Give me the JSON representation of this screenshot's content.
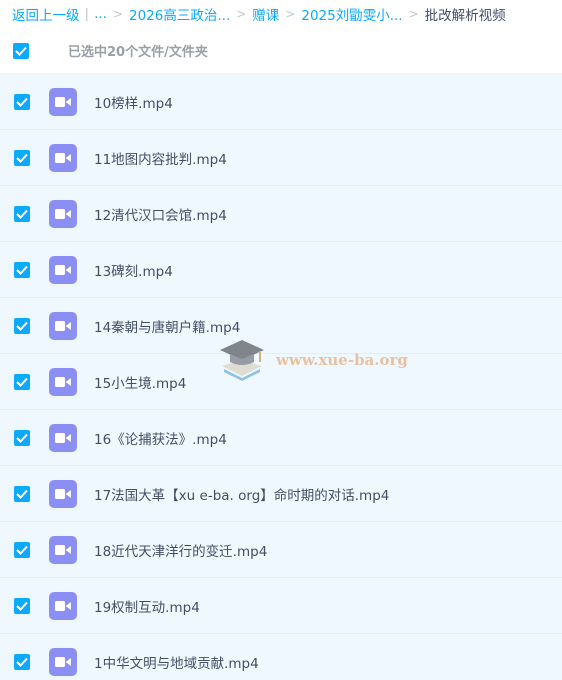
{
  "breadcrumb": {
    "back": "返回上一级",
    "ellipsis": "...",
    "items": [
      "2026高三政治...",
      "赠课",
      "2025刘勖雯小...",
      "批改解析视频"
    ]
  },
  "selection": {
    "label": "已选中20个文件/文件夹"
  },
  "files": [
    {
      "name": "10榜样.mp4"
    },
    {
      "name": "11地图内容批判.mp4"
    },
    {
      "name": "12清代汉口会馆.mp4"
    },
    {
      "name": "13碑刻.mp4"
    },
    {
      "name": "14秦朝与唐朝户籍.mp4"
    },
    {
      "name": "15小生境.mp4"
    },
    {
      "name": "16《论捕获法》.mp4"
    },
    {
      "name": "17法国大革【xu e-ba. org】命时期的对话.mp4"
    },
    {
      "name": "18近代天津洋行的变迁.mp4"
    },
    {
      "name": "19权制互动.mp4"
    },
    {
      "name": "1中华文明与地域贡献.mp4"
    }
  ],
  "watermark": {
    "text": "www.xue-ba.org"
  },
  "colors": {
    "accent": "#09aaff",
    "video_icon": "#8b8ff4",
    "row_bg": "#f0f8ff"
  }
}
